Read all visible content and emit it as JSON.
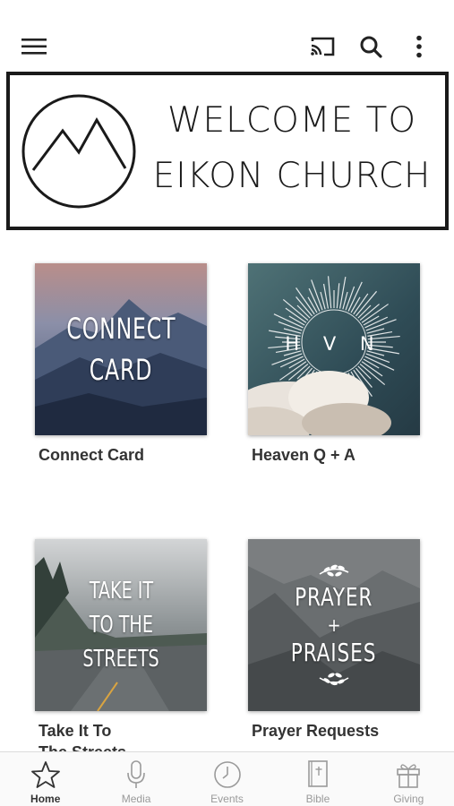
{
  "appbar": {
    "menu_icon": "hamburger-menu-icon",
    "cast_icon": "cast-icon",
    "search_icon": "search-icon",
    "more_icon": "more-vertical-icon"
  },
  "banner": {
    "line1": "WELCOME TO",
    "line2": "EIKON CHURCH"
  },
  "tiles": [
    {
      "caption": "Connect Card",
      "art_lines": [
        "CONNECT",
        "CARD"
      ]
    },
    {
      "caption": "Heaven Q + A",
      "art_text": "H V N"
    },
    {
      "caption_line1": "Take It To",
      "caption_line2": "The Streets",
      "art_lines": [
        "TAKE IT",
        "TO THE",
        "STREETS"
      ]
    },
    {
      "caption": "Prayer Requests",
      "art_line1": "PRAYER",
      "art_plus": "+",
      "art_line2": "PRAISES"
    }
  ],
  "tabbar": {
    "items": [
      {
        "label": "Home",
        "icon": "star-icon",
        "active": true
      },
      {
        "label": "Media",
        "icon": "microphone-icon"
      },
      {
        "label": "Events",
        "icon": "clock-icon"
      },
      {
        "label": "Bible",
        "icon": "bible-icon"
      },
      {
        "label": "Giving",
        "icon": "gift-icon"
      }
    ]
  },
  "colors": {
    "active_tab": "#333333",
    "inactive_tab": "#9a9a9a",
    "banner_border": "#1a1a1a"
  }
}
